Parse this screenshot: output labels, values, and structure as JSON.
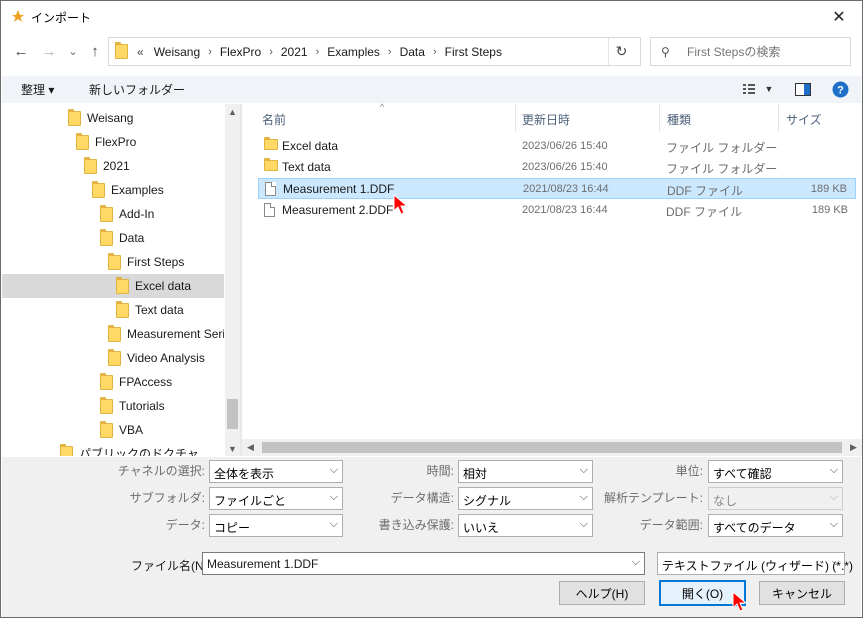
{
  "window": {
    "title": "インポート"
  },
  "nav": {
    "back_glyph": "←",
    "forward_glyph": "→",
    "recent_glyph": "⌄",
    "up_glyph": "↑",
    "breadcrumb_overflow": "«",
    "breadcrumbs": [
      "Weisang",
      "FlexPro",
      "2021",
      "Examples",
      "Data",
      "First Steps"
    ],
    "refresh_glyph": "↻",
    "search_placeholder": "First Stepsの検索"
  },
  "toolbar": {
    "organize_label": "整理 ▾",
    "new_folder_label": "新しいフォルダー",
    "view_icon": "view-options-icon",
    "pane_icon": "preview-pane-icon",
    "help_icon": "help-icon"
  },
  "tree": {
    "items": [
      {
        "label": "Weisang"
      },
      {
        "label": "FlexPro"
      },
      {
        "label": "2021"
      },
      {
        "label": "Examples"
      },
      {
        "label": "Add-In"
      },
      {
        "label": "Data"
      },
      {
        "label": "First Steps"
      },
      {
        "label": "Excel data",
        "selected": true
      },
      {
        "label": "Text data"
      },
      {
        "label": "Measurement Seri"
      },
      {
        "label": "Video Analysis"
      },
      {
        "label": "FPAccess"
      },
      {
        "label": "Tutorials"
      },
      {
        "label": "VBA"
      },
      {
        "label": "パブリックのドクチャ"
      }
    ]
  },
  "columns": {
    "name": "名前",
    "modified": "更新日時",
    "type": "種類",
    "size": "サイズ"
  },
  "files": [
    {
      "name": "Excel data",
      "modified": "2023/06/26 15:40",
      "type": "ファイル フォルダー",
      "size": "",
      "icon": "folder-icon"
    },
    {
      "name": "Text data",
      "modified": "2023/06/26 15:40",
      "type": "ファイル フォルダー",
      "size": "",
      "icon": "folder-icon"
    },
    {
      "name": "Measurement 1.DDF",
      "modified": "2021/08/23 16:44",
      "type": "DDF ファイル",
      "size": "189 KB",
      "icon": "file-icon",
      "selected": true
    },
    {
      "name": "Measurement 2.DDF",
      "modified": "2021/08/23 16:44",
      "type": "DDF ファイル",
      "size": "189 KB",
      "icon": "file-icon"
    }
  ],
  "options": {
    "channel_select": {
      "label": "チャネルの選択:",
      "value": "全体を表示"
    },
    "subfolder": {
      "label": "サブフォルダ:",
      "value": "ファイルごと"
    },
    "data": {
      "label": "データ:",
      "value": "コピー"
    },
    "time": {
      "label": "時間:",
      "value": "相対"
    },
    "data_structure": {
      "label": "データ構造:",
      "value": "シグナル"
    },
    "write_protect": {
      "label": "書き込み保護:",
      "value": "いいえ"
    },
    "unit": {
      "label": "単位:",
      "value": "すべて確認"
    },
    "analysis_template": {
      "label": "解析テンプレート:",
      "value": "なし"
    },
    "data_range": {
      "label": "データ範囲:",
      "value": "すべてのデータ"
    }
  },
  "filename": {
    "label": "ファイル名(N):",
    "value": "Measurement 1.DDF",
    "filter": "テキストファイル (ウィザード) (*.*)"
  },
  "buttons": {
    "help": "ヘルプ(H)",
    "open": "開く(O)",
    "cancel": "キャンセル"
  },
  "colors": {
    "selection": "#cce8ff",
    "folder": "#ffd965",
    "accent": "#0078d7",
    "cursor": "#ff0000"
  }
}
